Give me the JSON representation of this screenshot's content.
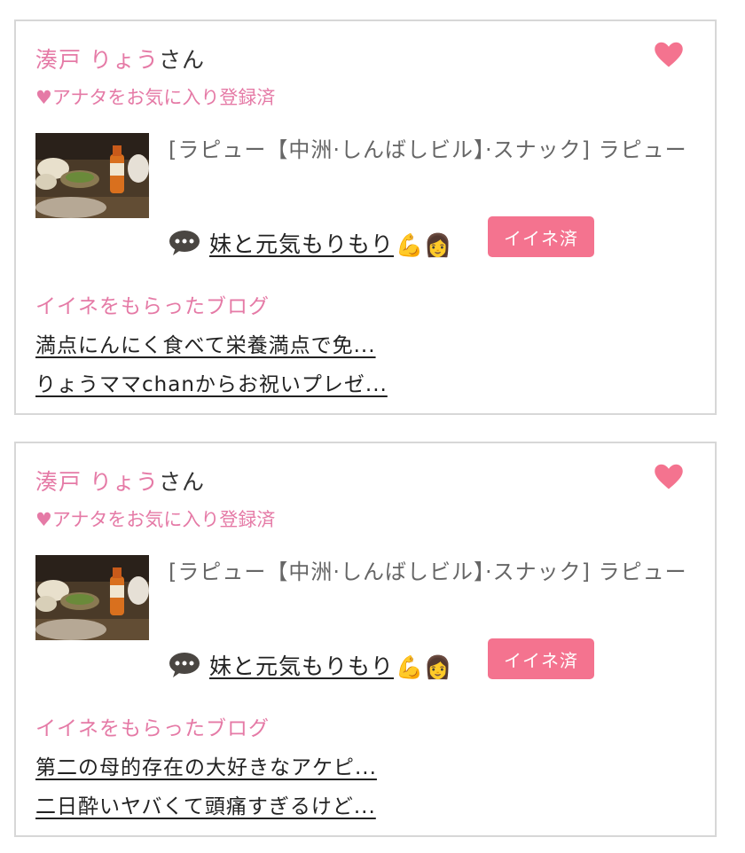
{
  "colors": {
    "accent_pink": "#e57aa6",
    "button_pink": "#f4738f",
    "border": "#d7d7d7"
  },
  "cards": [
    {
      "user_name": "湊戸 りょう",
      "honorific": "さん",
      "favorite_icon": "heart-icon",
      "favorite_status": "♥アナタをお気に入り登録済",
      "shop_text": "[ラピュー【中洲·しんばしビル】·スナック] ラピュー",
      "message": "妹と元気もりもり",
      "message_emojis": "💪👩",
      "like_button": "イイネ済",
      "blogs_title": "イイネをもらったブログ",
      "blogs": [
        "満点にんにく食べて栄養満点で免...",
        "りょうママchanからお祝いプレゼ..."
      ]
    },
    {
      "user_name": "湊戸 りょう",
      "honorific": "さん",
      "favorite_icon": "heart-icon",
      "favorite_status": "♥アナタをお気に入り登録済",
      "shop_text": "[ラピュー【中洲·しんばしビル】·スナック] ラピュー",
      "message": "妹と元気もりもり",
      "message_emojis": "💪👩",
      "like_button": "イイネ済",
      "blogs_title": "イイネをもらったブログ",
      "blogs": [
        "第二の母的存在の大好きなアケピ...",
        "二日酔いヤバくて頭痛すぎるけど..."
      ]
    }
  ]
}
